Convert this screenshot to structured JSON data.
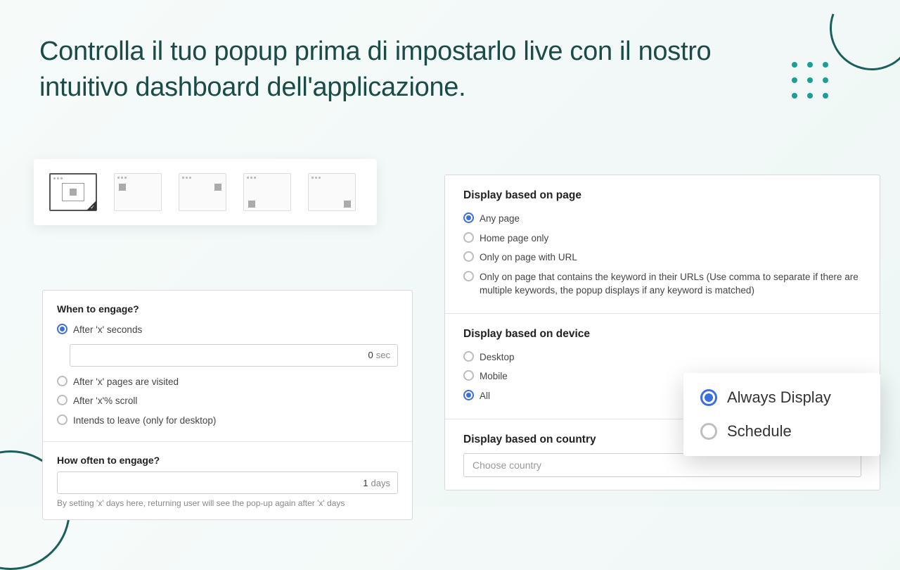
{
  "title": "Controlla il tuo popup prima di impostarlo live con il nostro intuitivo dashboard dell'applicazione.",
  "engage": {
    "when_title": "When to engage?",
    "options": {
      "after_seconds": "After 'x' seconds",
      "after_pages": "After 'x' pages are visited",
      "after_scroll": "After 'x'% scroll",
      "intends_leave": "Intends to leave (only for desktop)"
    },
    "seconds_value": "0",
    "seconds_unit": "sec",
    "how_often_title": "How often to engage?",
    "days_value": "1",
    "days_unit": "days",
    "hint": "By setting 'x' days here, returning user will see the pop-up again after 'x' days"
  },
  "display": {
    "page_title": "Display based on page",
    "page_options": {
      "any": "Any page",
      "home": "Home page only",
      "url": "Only on page with URL",
      "keyword": "Only on page that contains the keyword in their URLs (Use comma to separate if there are multiple keywords, the popup displays if any keyword is matched)"
    },
    "device_title": "Display based on device",
    "device_options": {
      "desktop": "Desktop",
      "mobile": "Mobile",
      "all": "All"
    },
    "country_title": "Display based on country",
    "country_placeholder": "Choose country"
  },
  "schedule": {
    "always": "Always Display",
    "schedule": "Schedule"
  }
}
